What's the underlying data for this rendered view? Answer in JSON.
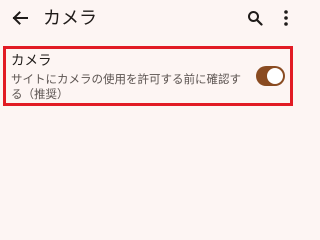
{
  "appbar": {
    "title": "カメラ",
    "back_icon": "arrow-left-icon",
    "search_icon": "search-icon",
    "more_icon": "more-vertical-icon"
  },
  "setting": {
    "title": "カメラ",
    "summary": "サイトにカメラの使用を許可する前に確認する（推奨）",
    "toggle_on": true
  },
  "colors": {
    "background": "#fdf5f3",
    "highlight_border": "#e21b24",
    "toggle_track": "#8a4b21",
    "text_primary": "#1f1b19",
    "text_secondary": "#5b5350"
  }
}
